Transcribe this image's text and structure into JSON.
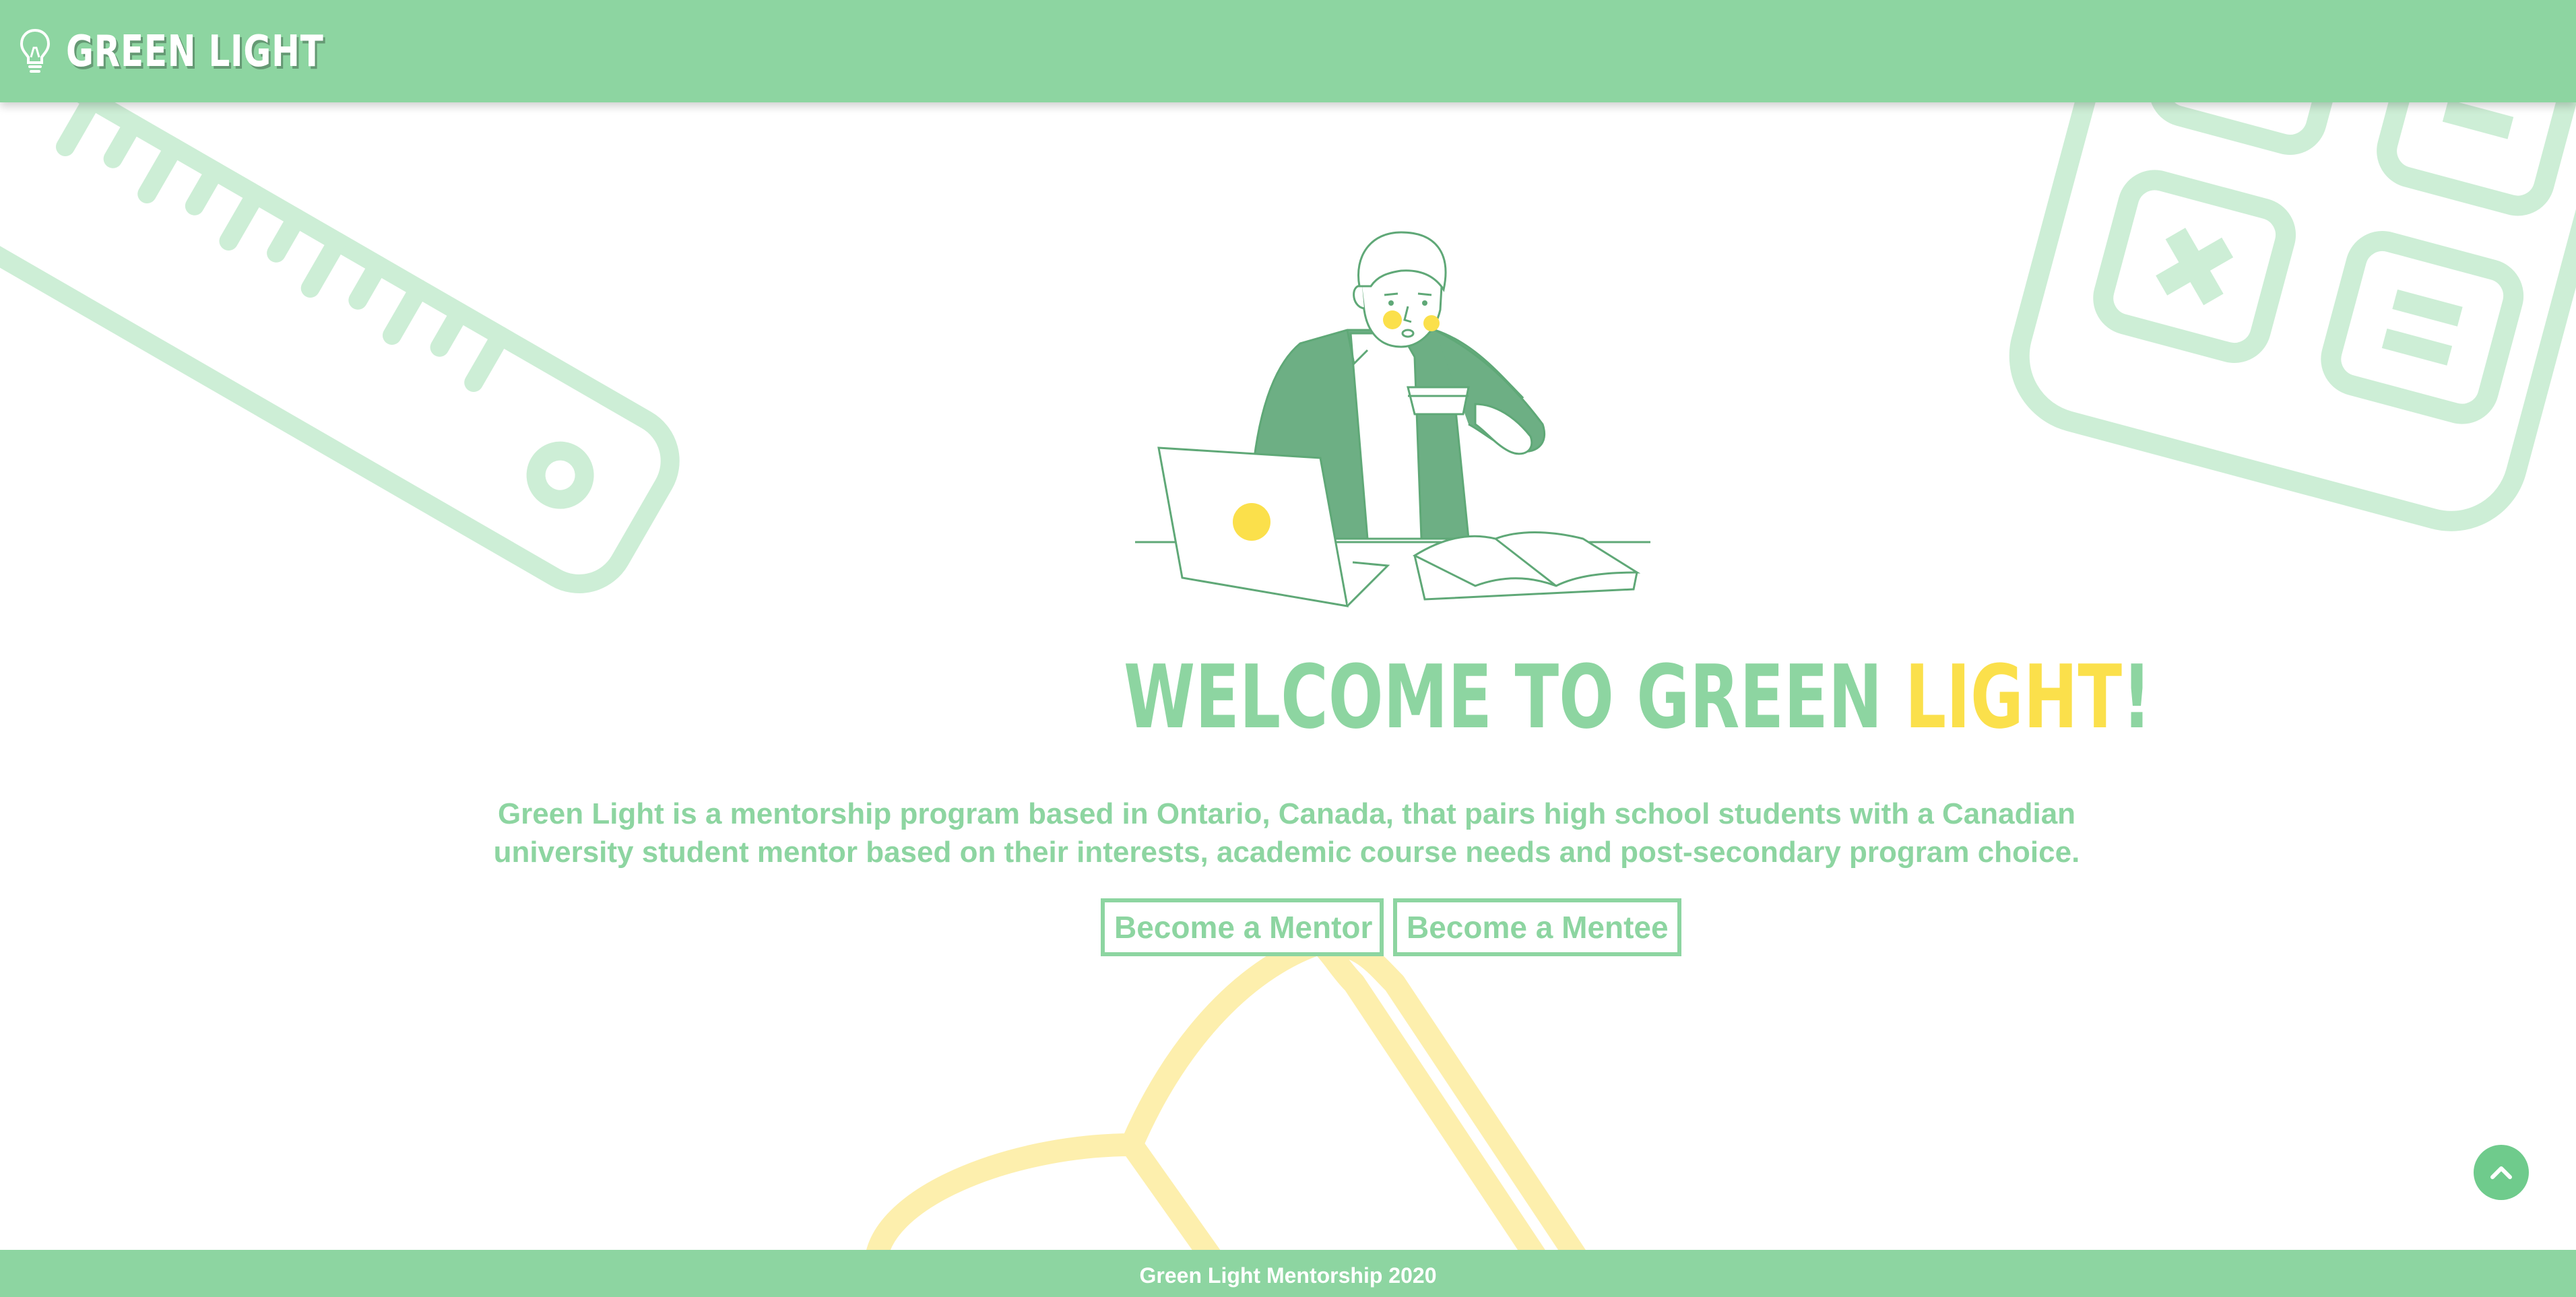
{
  "colors": {
    "brand_green": "#8dd5a1",
    "accent_yellow": "#fbe04b",
    "background": "#ffffff",
    "decor_green": "#cdeed6",
    "decor_yellow": "#fdefad"
  },
  "header": {
    "logo_icon": "lightbulb-icon",
    "brand_name": "Green Light"
  },
  "hero": {
    "illustration": "student-studying-illustration",
    "headline": {
      "part1": "Welcome to Green ",
      "part2": "Light",
      "part3": "!"
    },
    "description": "Green Light is a mentorship program based in Ontario, Canada, that pairs high school students with a Canadian university student mentor based on their interests, academic course needs and post-secondary program choice."
  },
  "actions": {
    "mentor_label": "Become a Mentor",
    "mentee_label": "Become a Mentee"
  },
  "back_to_top": {
    "icon": "chevron-up-icon"
  },
  "footer": {
    "text": "Green Light Mentorship 2020"
  },
  "decorations": [
    "ruler-icon",
    "calculator-icon",
    "pencil-icon"
  ]
}
